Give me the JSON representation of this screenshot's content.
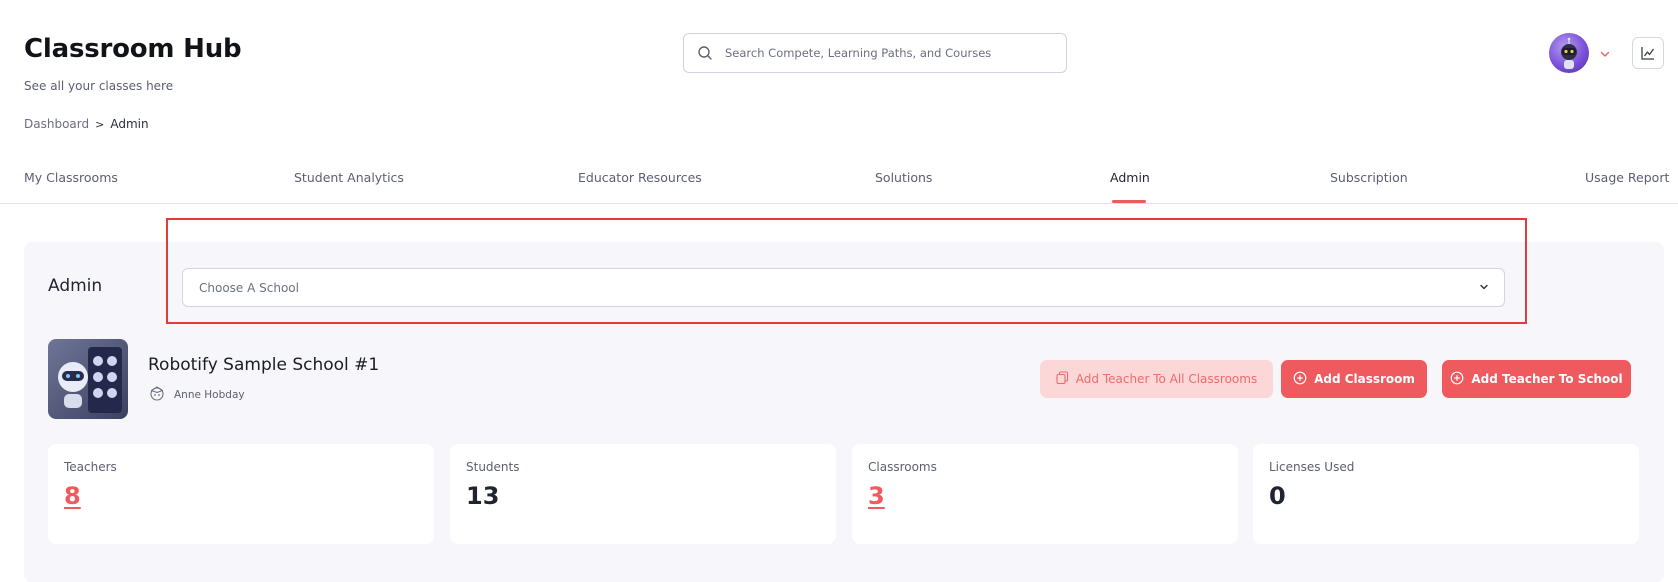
{
  "header": {
    "title": "Classroom Hub",
    "subtitle": "See all your classes here",
    "breadcrumb": {
      "parent": "Dashboard",
      "separator": ">",
      "current": "Admin"
    },
    "search_placeholder": "Search Compete, Learning Paths, and Courses"
  },
  "tabs": [
    {
      "label": "My Classrooms",
      "active": false
    },
    {
      "label": "Student Analytics",
      "active": false
    },
    {
      "label": "Educator Resources",
      "active": false
    },
    {
      "label": "Solutions",
      "active": false
    },
    {
      "label": "Admin",
      "active": true
    },
    {
      "label": "Subscription",
      "active": false
    },
    {
      "label": "Usage Report",
      "active": false
    }
  ],
  "admin": {
    "label": "Admin",
    "school_select_placeholder": "Choose A School"
  },
  "school": {
    "name": "Robotify Sample School #1",
    "teacher": "Anne Hobday"
  },
  "actions": {
    "add_teacher_all": "Add Teacher To All Classrooms",
    "add_classroom": "Add Classroom",
    "add_teacher_school": "Add Teacher To School"
  },
  "stats": [
    {
      "label": "Teachers",
      "value": "8"
    },
    {
      "label": "Students",
      "value": "13"
    },
    {
      "label": "Classrooms",
      "value": "3"
    },
    {
      "label": "Licenses Used",
      "value": "0"
    }
  ],
  "colors": {
    "accent": "#ef5a5f",
    "accent_light": "#fbd7d7",
    "highlight_border": "#e23b3b"
  }
}
